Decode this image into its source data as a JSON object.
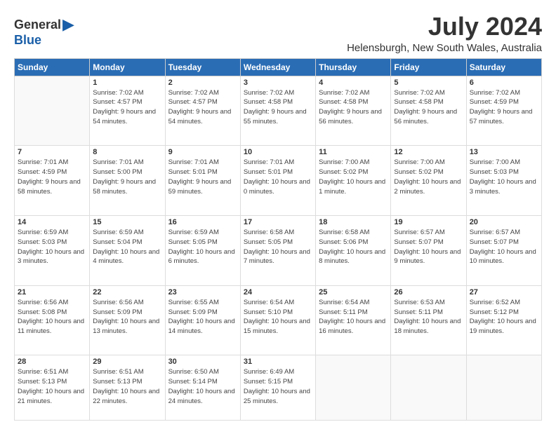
{
  "logo": {
    "general": "General",
    "blue": "Blue"
  },
  "title": "July 2024",
  "location": "Helensburgh, New South Wales, Australia",
  "headers": [
    "Sunday",
    "Monday",
    "Tuesday",
    "Wednesday",
    "Thursday",
    "Friday",
    "Saturday"
  ],
  "weeks": [
    [
      {
        "day": "",
        "sunrise": "",
        "sunset": "",
        "daylight": ""
      },
      {
        "day": "1",
        "sunrise": "Sunrise: 7:02 AM",
        "sunset": "Sunset: 4:57 PM",
        "daylight": "Daylight: 9 hours and 54 minutes."
      },
      {
        "day": "2",
        "sunrise": "Sunrise: 7:02 AM",
        "sunset": "Sunset: 4:57 PM",
        "daylight": "Daylight: 9 hours and 54 minutes."
      },
      {
        "day": "3",
        "sunrise": "Sunrise: 7:02 AM",
        "sunset": "Sunset: 4:58 PM",
        "daylight": "Daylight: 9 hours and 55 minutes."
      },
      {
        "day": "4",
        "sunrise": "Sunrise: 7:02 AM",
        "sunset": "Sunset: 4:58 PM",
        "daylight": "Daylight: 9 hours and 56 minutes."
      },
      {
        "day": "5",
        "sunrise": "Sunrise: 7:02 AM",
        "sunset": "Sunset: 4:58 PM",
        "daylight": "Daylight: 9 hours and 56 minutes."
      },
      {
        "day": "6",
        "sunrise": "Sunrise: 7:02 AM",
        "sunset": "Sunset: 4:59 PM",
        "daylight": "Daylight: 9 hours and 57 minutes."
      }
    ],
    [
      {
        "day": "7",
        "sunrise": "Sunrise: 7:01 AM",
        "sunset": "Sunset: 4:59 PM",
        "daylight": "Daylight: 9 hours and 58 minutes."
      },
      {
        "day": "8",
        "sunrise": "Sunrise: 7:01 AM",
        "sunset": "Sunset: 5:00 PM",
        "daylight": "Daylight: 9 hours and 58 minutes."
      },
      {
        "day": "9",
        "sunrise": "Sunrise: 7:01 AM",
        "sunset": "Sunset: 5:01 PM",
        "daylight": "Daylight: 9 hours and 59 minutes."
      },
      {
        "day": "10",
        "sunrise": "Sunrise: 7:01 AM",
        "sunset": "Sunset: 5:01 PM",
        "daylight": "Daylight: 10 hours and 0 minutes."
      },
      {
        "day": "11",
        "sunrise": "Sunrise: 7:00 AM",
        "sunset": "Sunset: 5:02 PM",
        "daylight": "Daylight: 10 hours and 1 minute."
      },
      {
        "day": "12",
        "sunrise": "Sunrise: 7:00 AM",
        "sunset": "Sunset: 5:02 PM",
        "daylight": "Daylight: 10 hours and 2 minutes."
      },
      {
        "day": "13",
        "sunrise": "Sunrise: 7:00 AM",
        "sunset": "Sunset: 5:03 PM",
        "daylight": "Daylight: 10 hours and 3 minutes."
      }
    ],
    [
      {
        "day": "14",
        "sunrise": "Sunrise: 6:59 AM",
        "sunset": "Sunset: 5:03 PM",
        "daylight": "Daylight: 10 hours and 3 minutes."
      },
      {
        "day": "15",
        "sunrise": "Sunrise: 6:59 AM",
        "sunset": "Sunset: 5:04 PM",
        "daylight": "Daylight: 10 hours and 4 minutes."
      },
      {
        "day": "16",
        "sunrise": "Sunrise: 6:59 AM",
        "sunset": "Sunset: 5:05 PM",
        "daylight": "Daylight: 10 hours and 6 minutes."
      },
      {
        "day": "17",
        "sunrise": "Sunrise: 6:58 AM",
        "sunset": "Sunset: 5:05 PM",
        "daylight": "Daylight: 10 hours and 7 minutes."
      },
      {
        "day": "18",
        "sunrise": "Sunrise: 6:58 AM",
        "sunset": "Sunset: 5:06 PM",
        "daylight": "Daylight: 10 hours and 8 minutes."
      },
      {
        "day": "19",
        "sunrise": "Sunrise: 6:57 AM",
        "sunset": "Sunset: 5:07 PM",
        "daylight": "Daylight: 10 hours and 9 minutes."
      },
      {
        "day": "20",
        "sunrise": "Sunrise: 6:57 AM",
        "sunset": "Sunset: 5:07 PM",
        "daylight": "Daylight: 10 hours and 10 minutes."
      }
    ],
    [
      {
        "day": "21",
        "sunrise": "Sunrise: 6:56 AM",
        "sunset": "Sunset: 5:08 PM",
        "daylight": "Daylight: 10 hours and 11 minutes."
      },
      {
        "day": "22",
        "sunrise": "Sunrise: 6:56 AM",
        "sunset": "Sunset: 5:09 PM",
        "daylight": "Daylight: 10 hours and 13 minutes."
      },
      {
        "day": "23",
        "sunrise": "Sunrise: 6:55 AM",
        "sunset": "Sunset: 5:09 PM",
        "daylight": "Daylight: 10 hours and 14 minutes."
      },
      {
        "day": "24",
        "sunrise": "Sunrise: 6:54 AM",
        "sunset": "Sunset: 5:10 PM",
        "daylight": "Daylight: 10 hours and 15 minutes."
      },
      {
        "day": "25",
        "sunrise": "Sunrise: 6:54 AM",
        "sunset": "Sunset: 5:11 PM",
        "daylight": "Daylight: 10 hours and 16 minutes."
      },
      {
        "day": "26",
        "sunrise": "Sunrise: 6:53 AM",
        "sunset": "Sunset: 5:11 PM",
        "daylight": "Daylight: 10 hours and 18 minutes."
      },
      {
        "day": "27",
        "sunrise": "Sunrise: 6:52 AM",
        "sunset": "Sunset: 5:12 PM",
        "daylight": "Daylight: 10 hours and 19 minutes."
      }
    ],
    [
      {
        "day": "28",
        "sunrise": "Sunrise: 6:51 AM",
        "sunset": "Sunset: 5:13 PM",
        "daylight": "Daylight: 10 hours and 21 minutes."
      },
      {
        "day": "29",
        "sunrise": "Sunrise: 6:51 AM",
        "sunset": "Sunset: 5:13 PM",
        "daylight": "Daylight: 10 hours and 22 minutes."
      },
      {
        "day": "30",
        "sunrise": "Sunrise: 6:50 AM",
        "sunset": "Sunset: 5:14 PM",
        "daylight": "Daylight: 10 hours and 24 minutes."
      },
      {
        "day": "31",
        "sunrise": "Sunrise: 6:49 AM",
        "sunset": "Sunset: 5:15 PM",
        "daylight": "Daylight: 10 hours and 25 minutes."
      },
      {
        "day": "",
        "sunrise": "",
        "sunset": "",
        "daylight": ""
      },
      {
        "day": "",
        "sunrise": "",
        "sunset": "",
        "daylight": ""
      },
      {
        "day": "",
        "sunrise": "",
        "sunset": "",
        "daylight": ""
      }
    ]
  ]
}
